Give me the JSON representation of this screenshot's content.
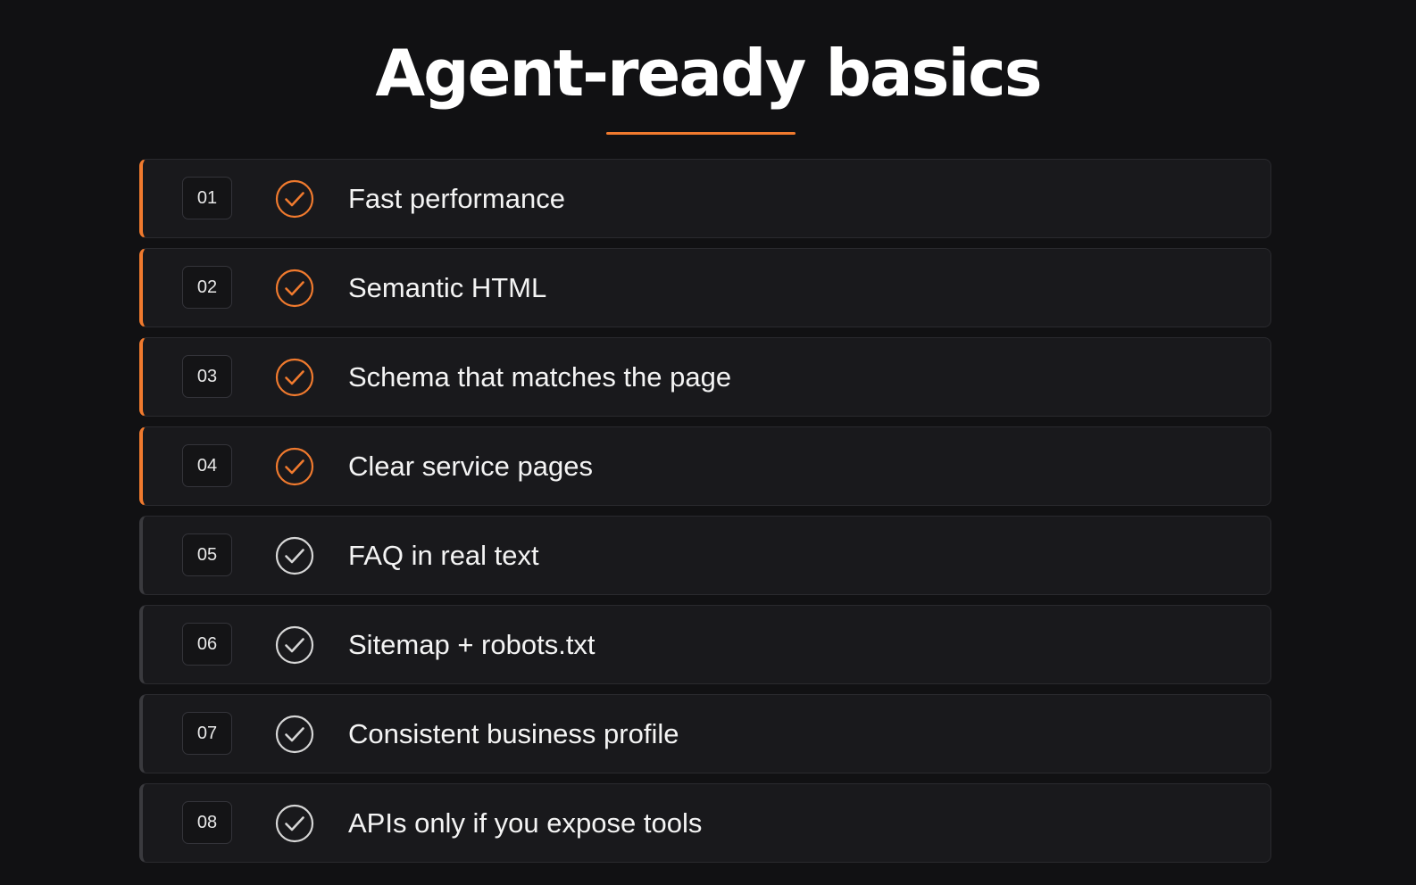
{
  "title": "Agent-ready basics",
  "colors": {
    "accent": "#f07a2e",
    "neutral_check": "#d6d6d6",
    "background": "#111113"
  },
  "items": [
    {
      "number": "01",
      "label": "Fast performance",
      "done": true,
      "icon": "check-circle-icon"
    },
    {
      "number": "02",
      "label": "Semantic HTML",
      "done": true,
      "icon": "check-circle-icon"
    },
    {
      "number": "03",
      "label": "Schema that matches the page",
      "done": true,
      "icon": "check-circle-icon"
    },
    {
      "number": "04",
      "label": "Clear service pages",
      "done": true,
      "icon": "check-circle-icon"
    },
    {
      "number": "05",
      "label": "FAQ in real text",
      "done": false,
      "icon": "check-circle-icon"
    },
    {
      "number": "06",
      "label": "Sitemap + robots.txt",
      "done": false,
      "icon": "check-circle-icon"
    },
    {
      "number": "07",
      "label": "Consistent business profile",
      "done": false,
      "icon": "check-circle-icon"
    },
    {
      "number": "08",
      "label": "APIs only if you expose tools",
      "done": false,
      "icon": "check-circle-icon"
    }
  ]
}
